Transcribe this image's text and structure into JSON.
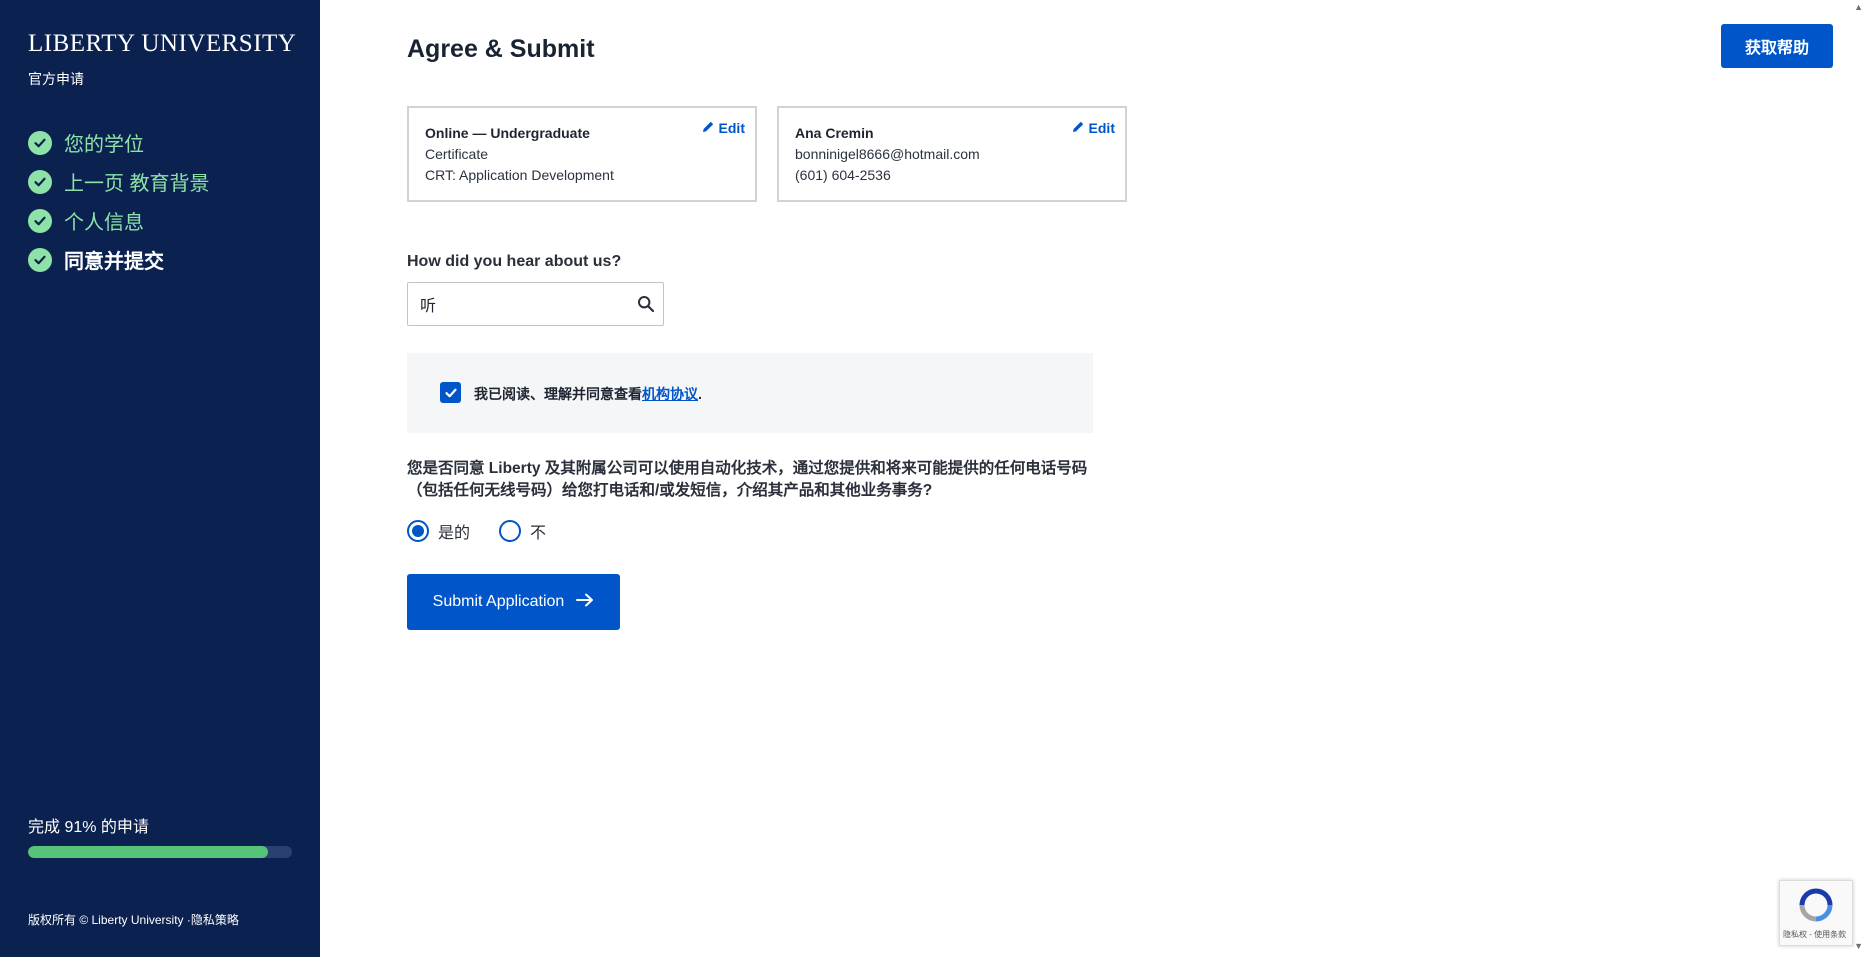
{
  "sidebar": {
    "brand": "LIBERTY UNIVERSITY",
    "subtitle": "官方申请",
    "steps": [
      {
        "label": "您的学位",
        "done": true
      },
      {
        "label": "上一页 教育背景",
        "done": true
      },
      {
        "label": "个人信息",
        "done": true
      },
      {
        "label": "同意并提交",
        "done": true,
        "active": true
      }
    ],
    "progress_text": "完成 91% 的申请",
    "progress_percent": 91,
    "footer": "版权所有 © Liberty University ·隐私策略"
  },
  "header": {
    "title": "Agree & Submit",
    "help_button": "获取帮助"
  },
  "program_card": {
    "title": "Online — Undergraduate",
    "line1": "Certificate",
    "line2": "CRT: Application Development",
    "edit_label": "Edit"
  },
  "contact_card": {
    "title": "Ana Cremin",
    "line1": "bonninigel8666@hotmail.com",
    "line2": "(601) 604-2536",
    "edit_label": "Edit"
  },
  "referral": {
    "label": "How did you hear about us?",
    "value": "听"
  },
  "consent": {
    "text": "我已阅读、理解并同意查看",
    "link": "机构协议",
    "suffix": ".",
    "checked": true
  },
  "automation": {
    "question": "您是否同意 Liberty 及其附属公司可以使用自动化技术，通过您提供和将来可能提供的任何电话号码（包括任何无线号码）给您打电话和/或发短信，介绍其产品和其他业务事务?",
    "options": [
      "是的",
      "不"
    ],
    "selected": "是的"
  },
  "submit": {
    "label": "Submit Application"
  },
  "recaptcha": {
    "terms": "隐私权 - 使用条款"
  },
  "colors": {
    "sidebar_bg": "#0b2250",
    "accent": "#0056c8",
    "step_green": "#8ee2a8",
    "progress_green": "#56c378"
  }
}
